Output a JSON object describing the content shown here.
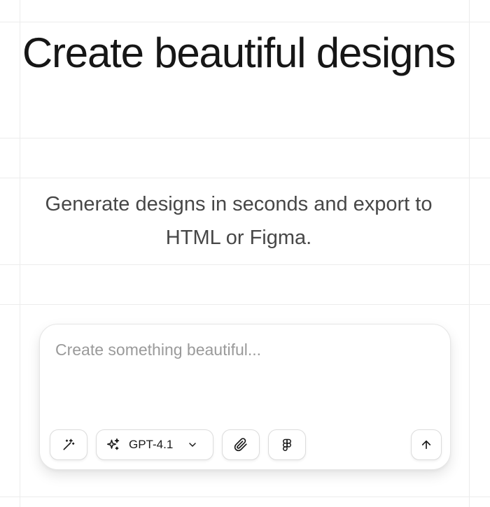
{
  "hero": {
    "title": "Create beautiful designs",
    "subtitle": "Generate designs in seconds and export to HTML or Figma."
  },
  "prompt": {
    "placeholder": "Create something beautiful...",
    "value": ""
  },
  "toolbar": {
    "model_label": "GPT-4.1",
    "icons": {
      "enhance": "magic-wand-icon",
      "model": "sparkles-icon",
      "model_dropdown": "chevron-down-icon",
      "attach": "paperclip-icon",
      "figma": "figma-icon",
      "send": "arrow-up-icon"
    }
  },
  "colors": {
    "background": "#ffffff",
    "grid": "#ececec",
    "title": "#161616",
    "subtitle": "#474747",
    "placeholder": "#9a9a9a",
    "button_border": "#dcdcdc"
  }
}
